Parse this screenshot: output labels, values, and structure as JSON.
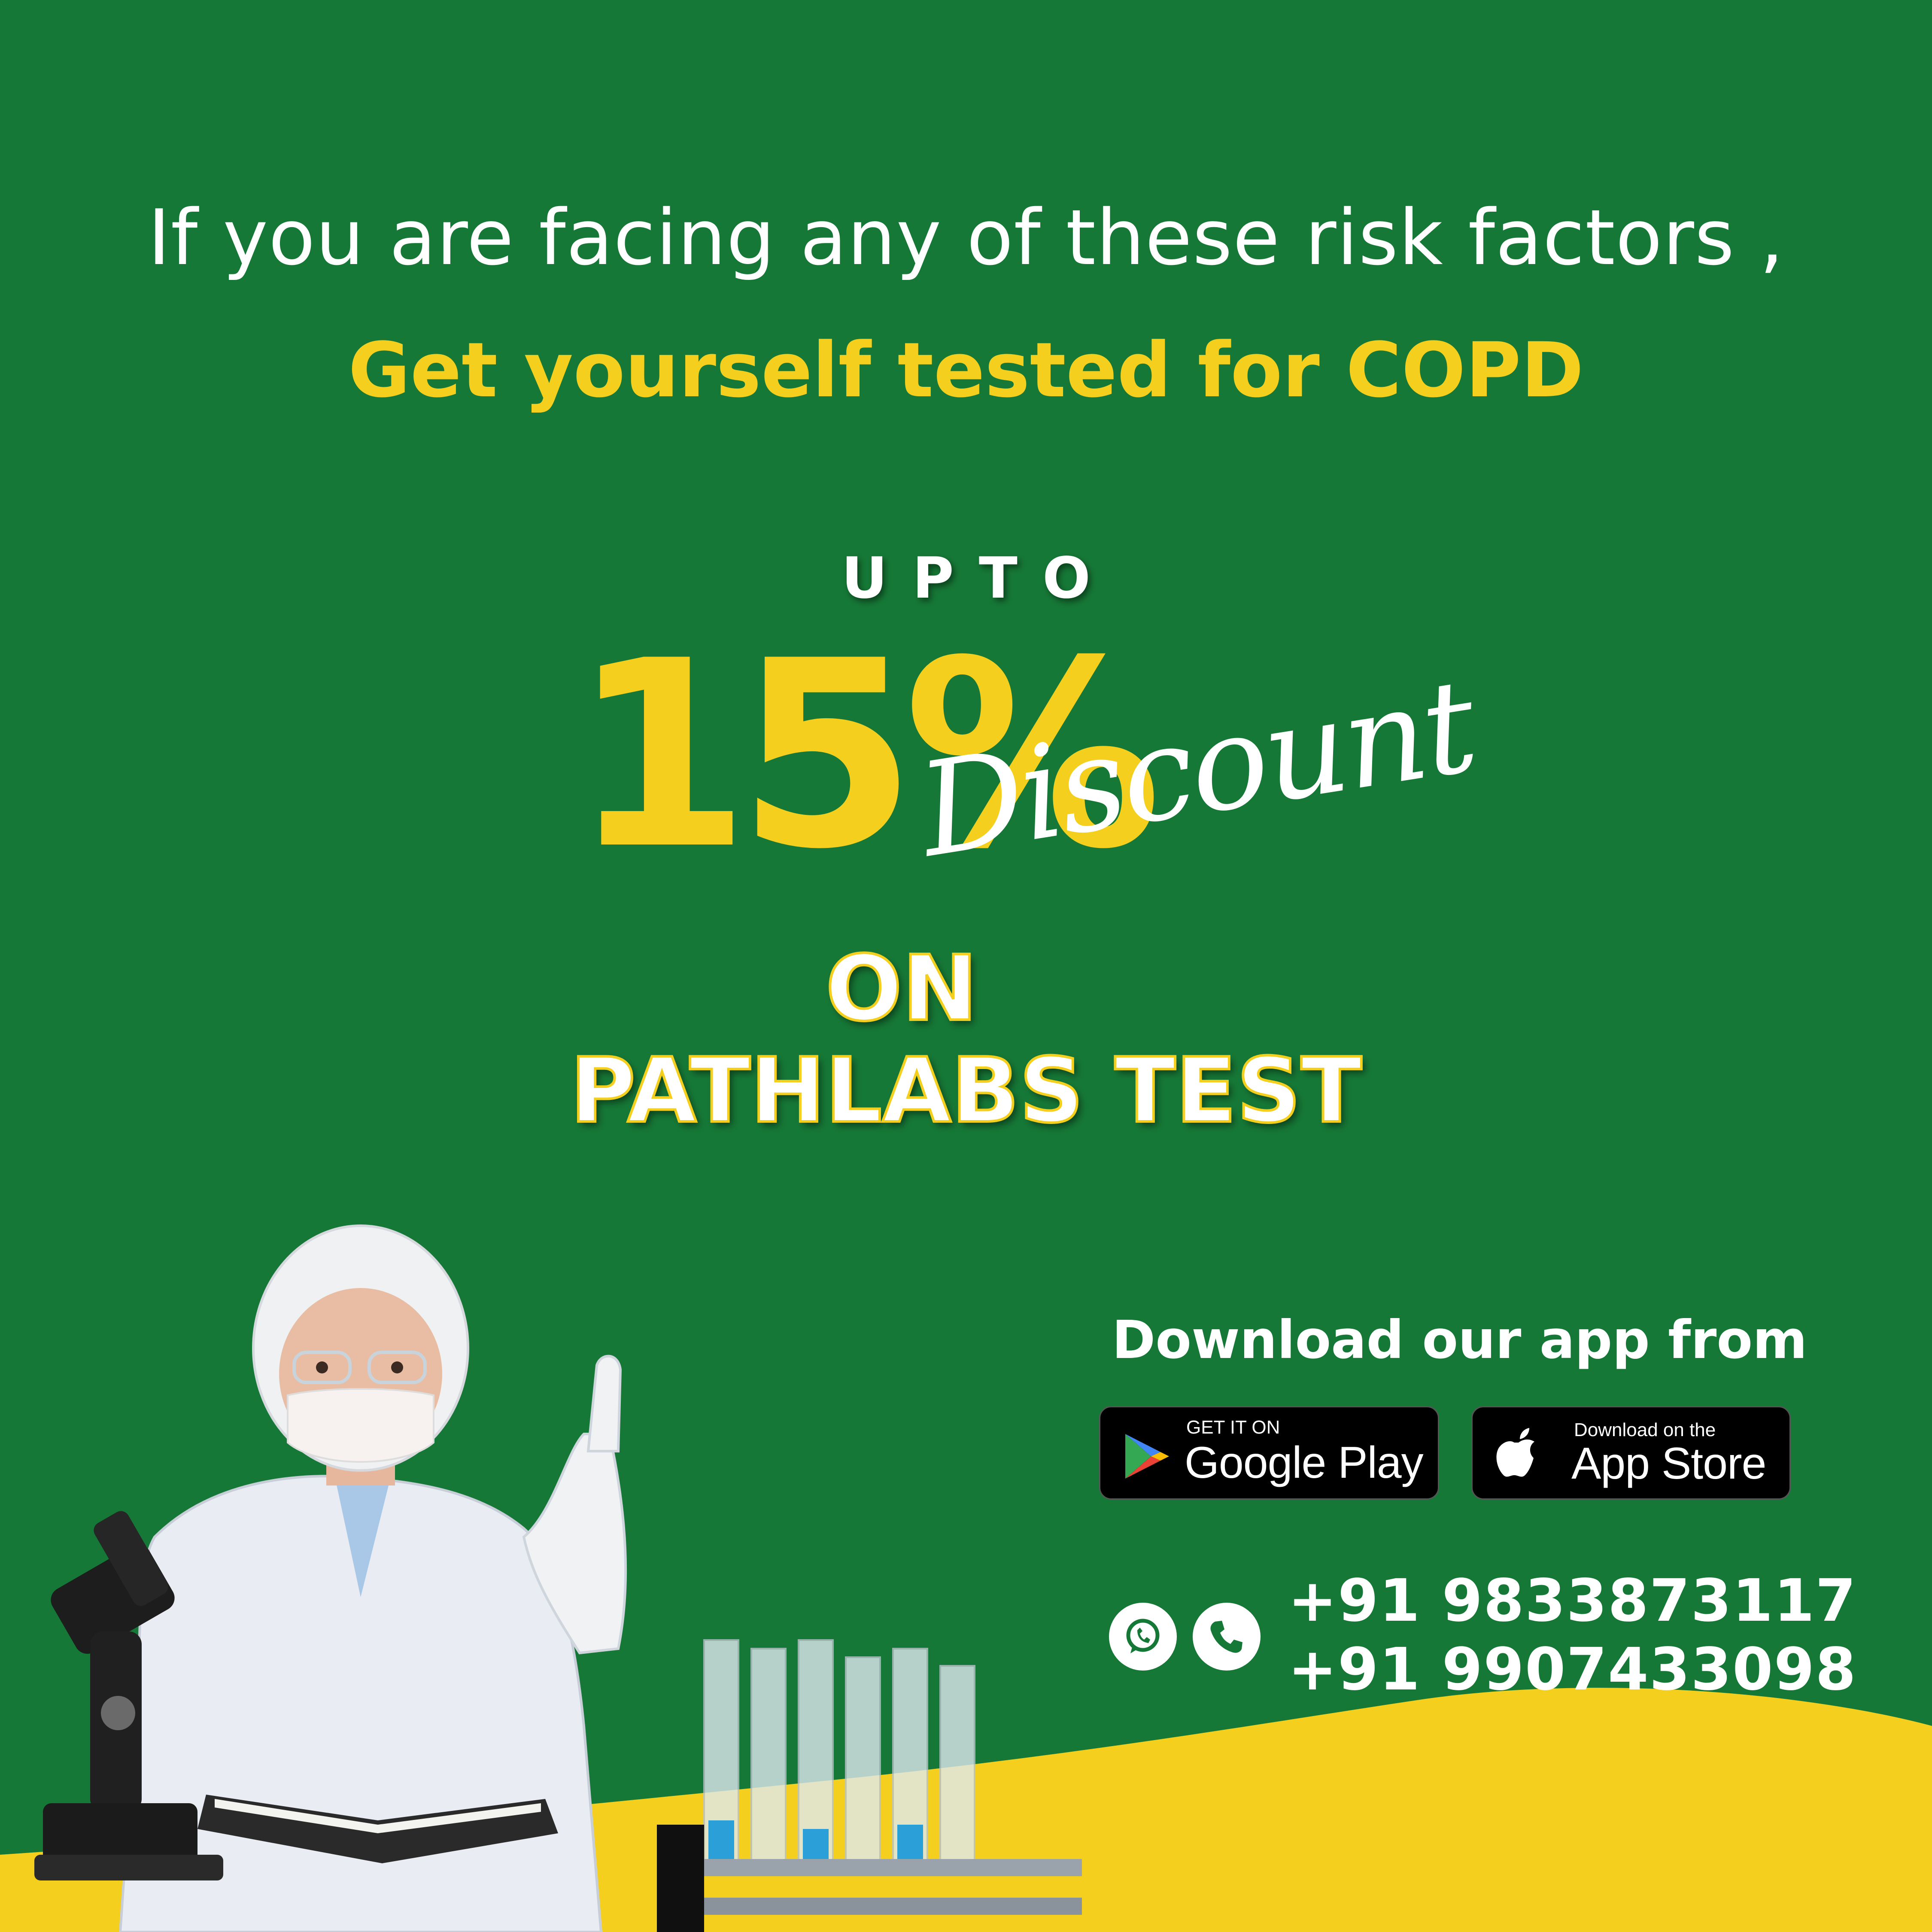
{
  "headline": "If you are facing any of these risk factors ,",
  "subheadline": "Get yourself tested for COPD",
  "offer": {
    "prefix": "UPTO",
    "value": "15%",
    "script_word": "Discount",
    "line1": "ON",
    "line2": "PATHLABS TEST"
  },
  "download": {
    "title": "Download our app from",
    "google_play": {
      "small": "GET IT ON",
      "big": "Google Play"
    },
    "app_store": {
      "small": "Download on the",
      "big": "App Store"
    }
  },
  "contact": {
    "phones": [
      "+91 9833873117",
      "+91 9907433098"
    ],
    "icons": [
      "whatsapp-icon",
      "phone-icon"
    ]
  },
  "colors": {
    "background": "#167836",
    "accent": "#f5cf1d",
    "text": "#ffffff"
  }
}
